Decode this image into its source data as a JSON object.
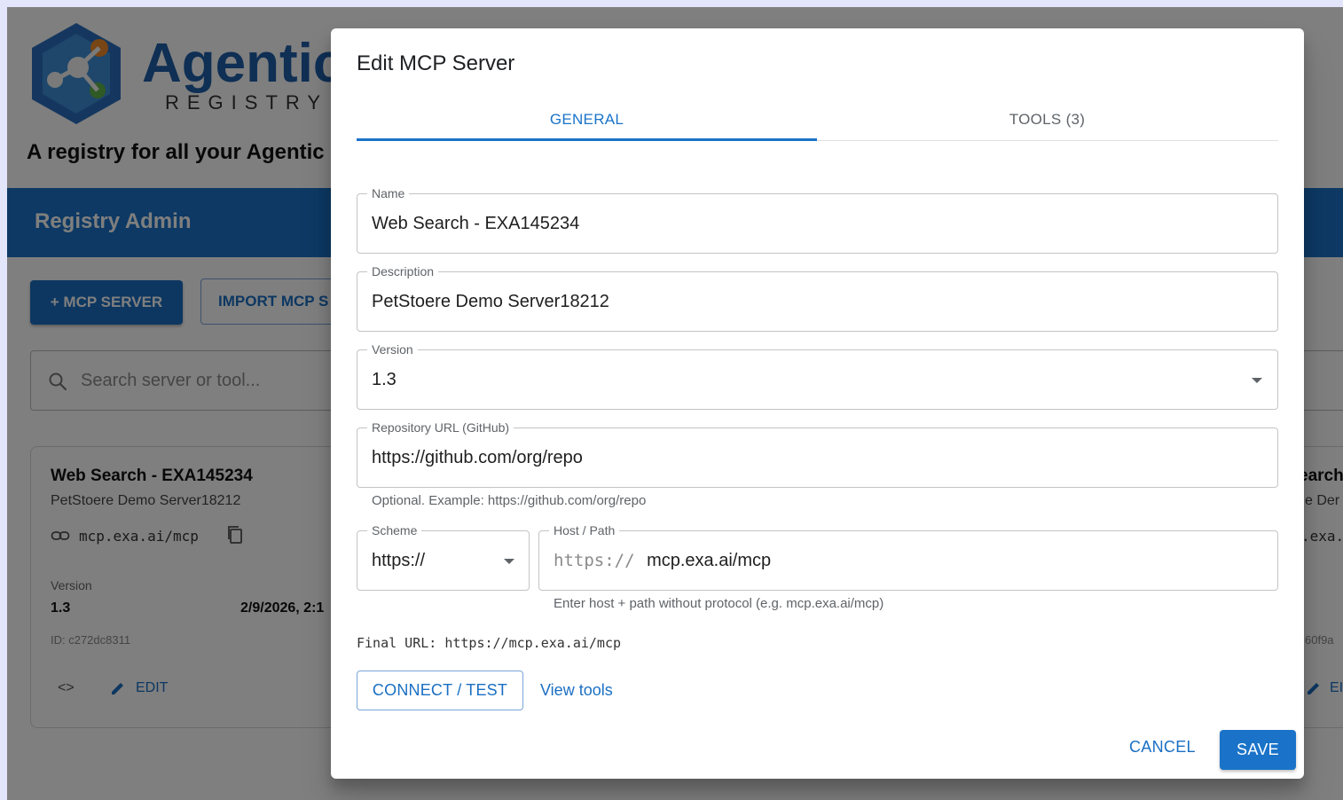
{
  "brand": {
    "name": "Agentic",
    "sub": "REGISTRY",
    "tagline": "A registry for all your Agentic"
  },
  "topbar": {
    "title": "Registry Admin"
  },
  "actions": {
    "add_label": "+ MCP SERVER",
    "import_label": "IMPORT MCP S"
  },
  "search": {
    "placeholder": "Search server or tool..."
  },
  "card": {
    "title": "Web Search - EXA145234",
    "description": "PetStoere Demo Server18212",
    "url": "mcp.exa.ai/mcp",
    "version_label": "Version",
    "version": "1.3",
    "date": "2/9/2026, 2:1",
    "id": "ID: c272dc8311",
    "code_glyph": "<>",
    "edit_label": "EDIT"
  },
  "card2": {
    "title": "earch",
    "description": "e Der",
    "url": ".exa.",
    "id": "60f9a",
    "edit_label": "EI"
  },
  "dialog": {
    "title": "Edit MCP Server",
    "tabs": [
      {
        "label": "GENERAL",
        "active": true
      },
      {
        "label": "TOOLS (3)",
        "active": false
      }
    ],
    "fields": {
      "name": {
        "label": "Name",
        "value": "Web Search - EXA145234"
      },
      "description": {
        "label": "Description",
        "value": "PetStoere Demo Server18212"
      },
      "version": {
        "label": "Version",
        "value": "1.3"
      },
      "repo": {
        "label": "Repository URL (GitHub)",
        "value": "https://github.com/org/repo",
        "helper": "Optional. Example: https://github.com/org/repo"
      },
      "scheme": {
        "label": "Scheme",
        "value": "https://"
      },
      "host": {
        "label": "Host / Path",
        "prefix": "https://",
        "value": "mcp.exa.ai/mcp",
        "helper": "Enter host + path without protocol (e.g. mcp.exa.ai/mcp)"
      }
    },
    "final_url": "Final URL: https://mcp.exa.ai/mcp",
    "connect_label": "CONNECT / TEST",
    "view_tools_label": "View tools",
    "cancel_label": "CANCEL",
    "save_label": "SAVE"
  },
  "colors": {
    "primary": "#1a73c9",
    "scrim": "rgba(0,0,0,0.5)",
    "page_bg": "#e3e6fb"
  },
  "icons": [
    "search-icon",
    "link-icon",
    "copy-icon",
    "code-icon",
    "pencil-icon",
    "dropdown-caret-icon"
  ]
}
